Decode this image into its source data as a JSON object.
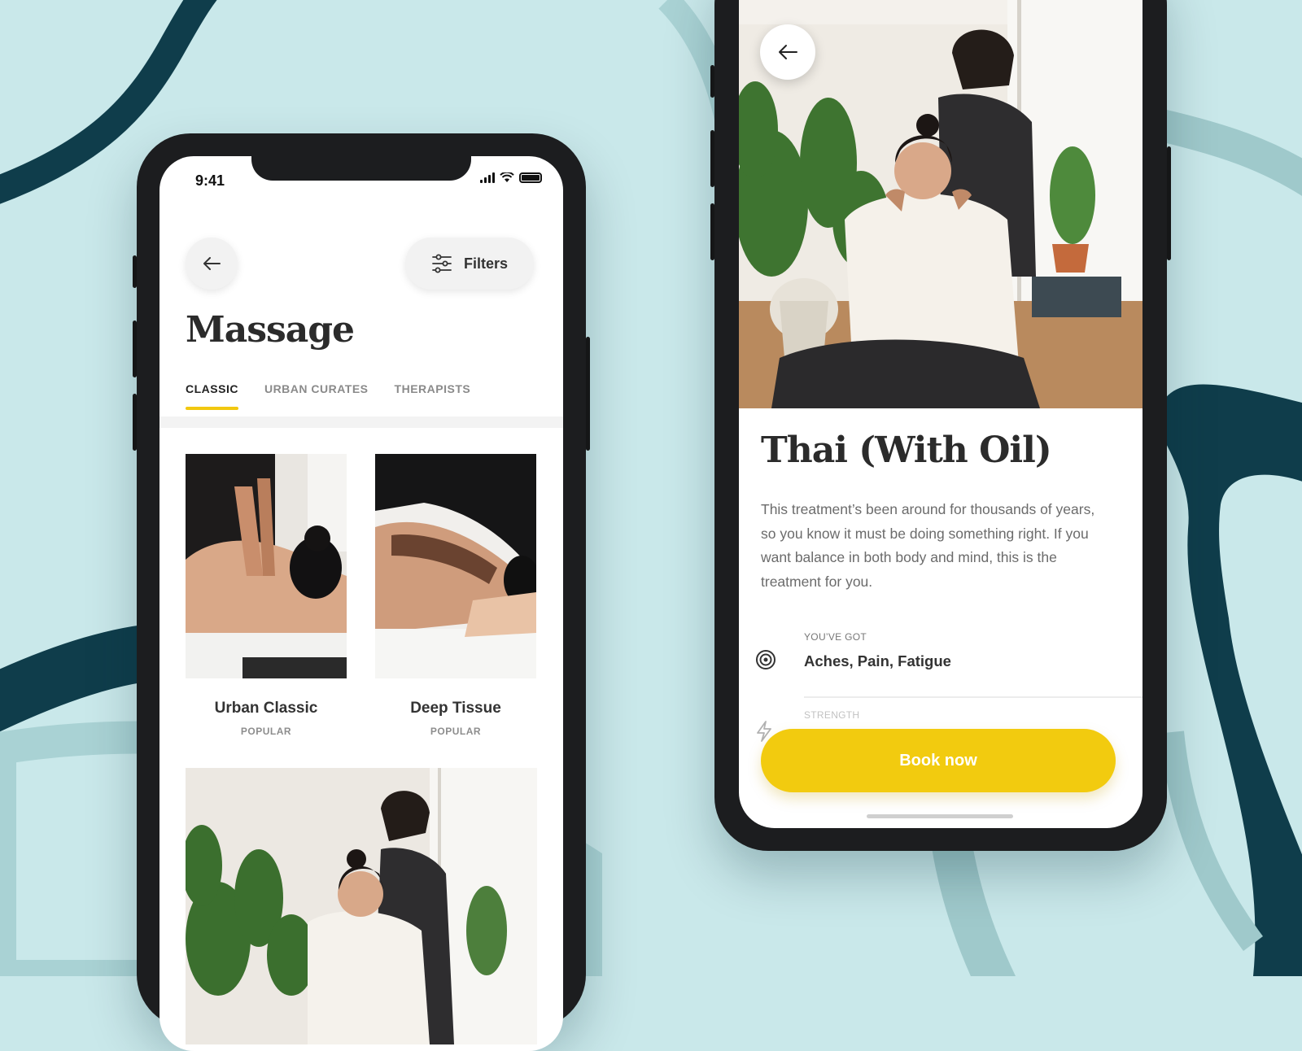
{
  "left_screen": {
    "status_time": "9:41",
    "filters_label": "Filters",
    "page_title": "Massage",
    "tabs": [
      {
        "label": "CLASSIC",
        "active": true
      },
      {
        "label": "URBAN CURATES",
        "active": false
      },
      {
        "label": "THERAPISTS",
        "active": false
      }
    ],
    "cards": [
      {
        "name": "Urban Classic",
        "badge": "POPULAR"
      },
      {
        "name": "Deep Tissue",
        "badge": "POPULAR"
      }
    ]
  },
  "right_screen": {
    "title": "Thai (With Oil)",
    "description": "This treatment’s been around for thousands of years, so you know it must be doing something right. If you want balance in both body and mind, this is the treatment for you.",
    "youve_got_label": "YOU’VE GOT",
    "youve_got_value": "Aches, Pain, Fatigue",
    "strength_label": "STRENGTH",
    "book_button": "Book now"
  },
  "colors": {
    "background": "#c9e8ea",
    "accent_yellow": "#f2c80f",
    "dark_teal": "#0f3d4b"
  },
  "icons": [
    "back-arrow-icon",
    "filters-sliders-icon",
    "signal-icon",
    "wifi-icon",
    "battery-icon",
    "target-icon",
    "lightning-icon"
  ]
}
